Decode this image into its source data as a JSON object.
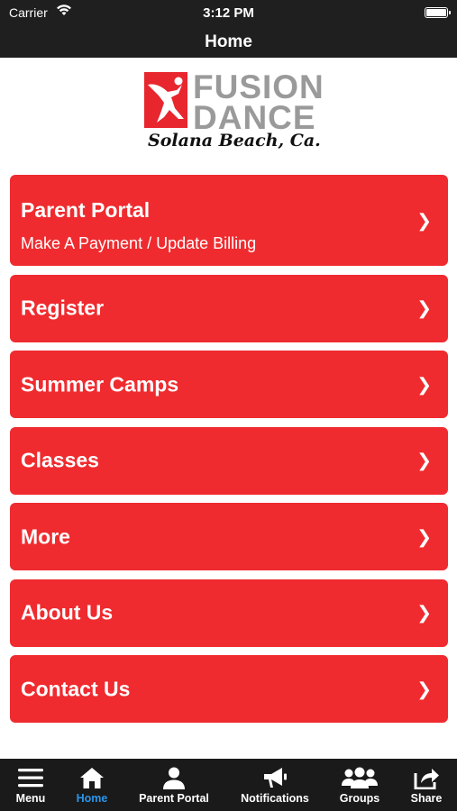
{
  "status": {
    "carrier": "Carrier",
    "time": "3:12 PM"
  },
  "nav": {
    "title": "Home"
  },
  "logo": {
    "line1": "FUSION",
    "line2": "DANCE",
    "tagline": "Solana Beach, Ca."
  },
  "menu": [
    {
      "label": "Parent Portal",
      "sublabel": "Make A Payment / Update Billing"
    },
    {
      "label": "Register"
    },
    {
      "label": "Summer Camps"
    },
    {
      "label": "Classes"
    },
    {
      "label": "More"
    },
    {
      "label": "About Us"
    },
    {
      "label": "Contact Us"
    }
  ],
  "chevron": "❯",
  "tabs": [
    {
      "label": "Menu",
      "icon": "hamburger-icon"
    },
    {
      "label": "Home",
      "icon": "home-icon",
      "active": true
    },
    {
      "label": "Parent Portal",
      "icon": "person-icon"
    },
    {
      "label": "Notifications",
      "icon": "megaphone-icon"
    },
    {
      "label": "Groups",
      "icon": "group-icon"
    },
    {
      "label": "Share",
      "icon": "share-icon"
    }
  ],
  "colors": {
    "brand_red": "#ef2b2f",
    "bar_dark": "#1f1f1f",
    "active_tab": "#2b95ea",
    "logo_gray": "#9a9a9a"
  }
}
